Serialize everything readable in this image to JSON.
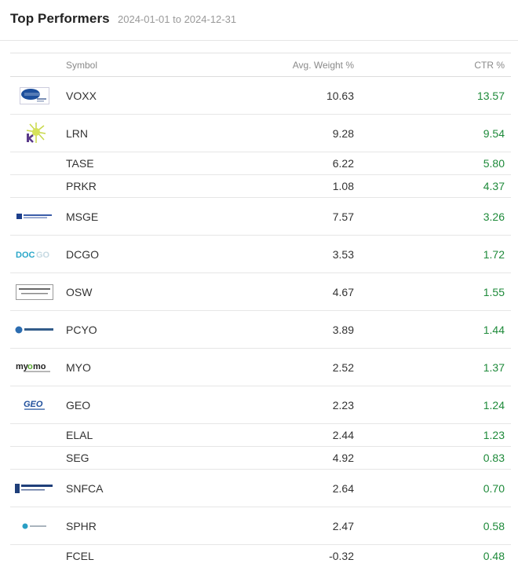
{
  "header": {
    "title": "Top Performers",
    "date_range": "2024-01-01 to 2024-12-31"
  },
  "table": {
    "columns": {
      "symbol": "Symbol",
      "weight": "Avg. Weight %",
      "ctr": "CTR %"
    },
    "rows": [
      {
        "symbol": "VOXX",
        "weight": "10.63",
        "ctr": "13.57",
        "logo": "voxx-logo"
      },
      {
        "symbol": "LRN",
        "weight": "9.28",
        "ctr": "9.54",
        "logo": "lrn-logo"
      },
      {
        "symbol": "TASE",
        "weight": "6.22",
        "ctr": "5.80",
        "logo": ""
      },
      {
        "symbol": "PRKR",
        "weight": "1.08",
        "ctr": "4.37",
        "logo": ""
      },
      {
        "symbol": "MSGE",
        "weight": "7.57",
        "ctr": "3.26",
        "logo": "msge-logo"
      },
      {
        "symbol": "DCGO",
        "weight": "3.53",
        "ctr": "1.72",
        "logo": "dcgo-logo"
      },
      {
        "symbol": "OSW",
        "weight": "4.67",
        "ctr": "1.55",
        "logo": "osw-logo"
      },
      {
        "symbol": "PCYO",
        "weight": "3.89",
        "ctr": "1.44",
        "logo": "pcyo-logo"
      },
      {
        "symbol": "MYO",
        "weight": "2.52",
        "ctr": "1.37",
        "logo": "myo-logo"
      },
      {
        "symbol": "GEO",
        "weight": "2.23",
        "ctr": "1.24",
        "logo": "geo-logo"
      },
      {
        "symbol": "ELAL",
        "weight": "2.44",
        "ctr": "1.23",
        "logo": ""
      },
      {
        "symbol": "SEG",
        "weight": "4.92",
        "ctr": "0.83",
        "logo": ""
      },
      {
        "symbol": "SNFCA",
        "weight": "2.64",
        "ctr": "0.70",
        "logo": "snfca-logo"
      },
      {
        "symbol": "SPHR",
        "weight": "2.47",
        "ctr": "0.58",
        "logo": "sphr-logo"
      },
      {
        "symbol": "FCEL",
        "weight": "-0.32",
        "ctr": "0.48",
        "logo": ""
      }
    ]
  },
  "colors": {
    "positive": "#1e8a3a",
    "muted": "#999999",
    "border": "#e6e6e6"
  }
}
